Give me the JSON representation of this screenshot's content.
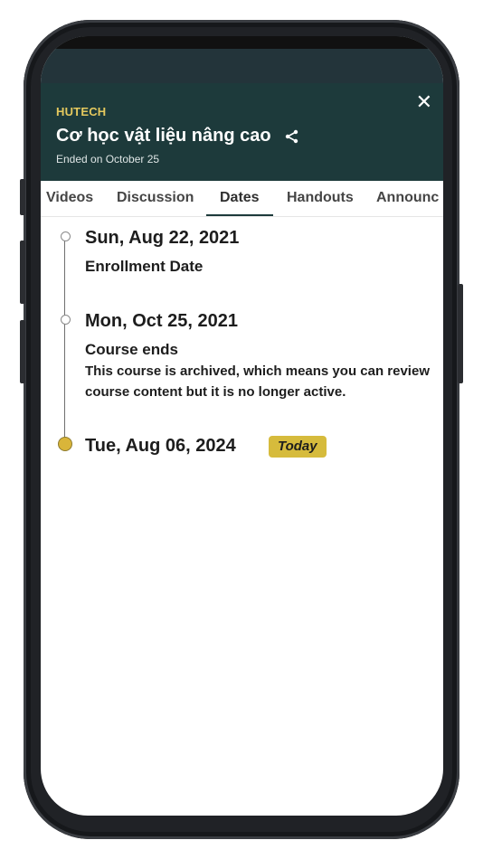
{
  "header": {
    "org": "HUTECH",
    "course_title": "Cơ học vật liệu nâng cao",
    "subtitle": "Ended on October 25",
    "close_symbol": "✕"
  },
  "tabs": [
    {
      "label": "Videos"
    },
    {
      "label": "Discussion"
    },
    {
      "label": "Dates"
    },
    {
      "label": "Handouts"
    },
    {
      "label": "Announc"
    }
  ],
  "timeline": [
    {
      "date": "Sun, Aug 22, 2021",
      "title": "Enrollment Date",
      "description": ""
    },
    {
      "date": "Mon, Oct 25, 2021",
      "title": "Course ends",
      "description": "This course is archived, which means you can review course content but it is no longer active."
    },
    {
      "date": "Tue, Aug 06, 2024",
      "badge": "Today"
    }
  ],
  "colors": {
    "header_bg": "#1d3a3b",
    "accent_gold": "#d6bb3c",
    "org_text": "#e5c95e"
  }
}
